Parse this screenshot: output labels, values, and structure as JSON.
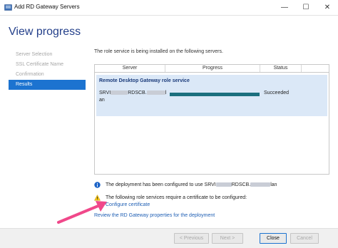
{
  "window": {
    "title": "Add RD Gateway Servers",
    "min_glyph": "—",
    "max_glyph": "☐",
    "close_glyph": "✕"
  },
  "page": {
    "title": "View progress"
  },
  "sidebar": {
    "items": [
      {
        "label": "Server Selection",
        "active": false
      },
      {
        "label": "SSL Certificate Name",
        "active": false
      },
      {
        "label": "Confirmation",
        "active": false
      },
      {
        "label": "Results",
        "active": true
      }
    ]
  },
  "main": {
    "intro": "The role service is being installed on the following servers.",
    "table": {
      "columns": [
        "Server",
        "Progress",
        "Status"
      ],
      "group_title": "Remote Desktop Gateway role service",
      "row": {
        "server_part1": "SRVI",
        "server_part2": "RDSCB.",
        "server_part3": "l",
        "server_part4": "an",
        "progress_percent": 100,
        "status": "Succeeded"
      }
    },
    "info_note_prefix": "The deployment has been configured to use SRVI",
    "info_note_mid": "RDSCB.",
    "info_note_suffix": "lan",
    "warn_note": "The following role services require a certificate to be configured:",
    "configure_link": "Configure certificate",
    "review_link": "Review the RD Gateway properties for the deployment"
  },
  "footer": {
    "prev": "< Previous",
    "next": "Next >",
    "close": "Close",
    "cancel": "Cancel"
  },
  "colors": {
    "accent": "#1c73d0",
    "progress": "#1b6f7e",
    "arrow": "#f0488a",
    "link": "#1f5fb4"
  }
}
